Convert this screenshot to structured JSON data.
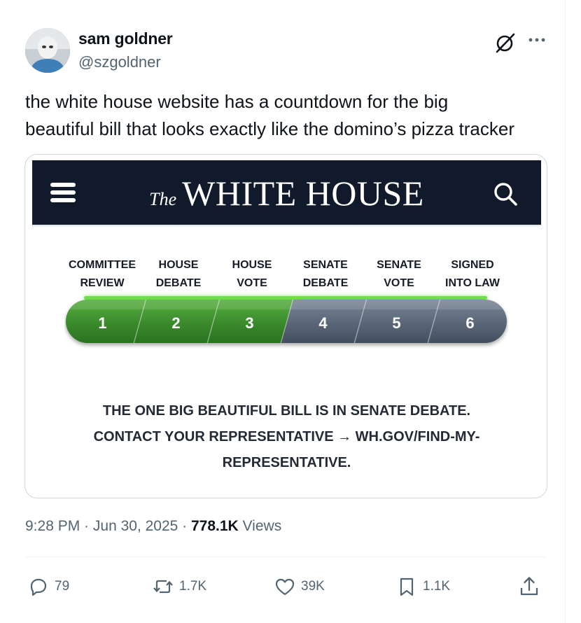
{
  "author": {
    "name": "sam goldner",
    "handle": "@szgoldner"
  },
  "tweet": {
    "text_line1": "the white house website has a countdown for the big",
    "text_line2": "beautiful bill that looks exactly like the domino’s pizza tracker"
  },
  "screenshot": {
    "logo_the": "The",
    "logo_main": "WHITE HOUSE",
    "stages": [
      {
        "label_line1": "COMMITTEE",
        "label_line2": "REVIEW",
        "number": "1"
      },
      {
        "label_line1": "HOUSE",
        "label_line2": "DEBATE",
        "number": "2"
      },
      {
        "label_line1": "HOUSE",
        "label_line2": "VOTE",
        "number": "3"
      },
      {
        "label_line1": "SENATE",
        "label_line2": "DEBATE",
        "number": "4"
      },
      {
        "label_line1": "SENATE",
        "label_line2": "VOTE",
        "number": "5"
      },
      {
        "label_line1": "SIGNED",
        "label_line2": "INTO LAW",
        "number": "6"
      }
    ],
    "completed_stages": 3,
    "message_line1": "THE ONE BIG BEAUTIFUL BILL IS IN SENATE DEBATE.",
    "message_line2": "CONTACT YOUR REPRESENTATIVE → WH.GOV/FIND-MY-",
    "message_line3": "REPRESENTATIVE."
  },
  "meta": {
    "time": "9:28 PM",
    "sep1": " · ",
    "date": "Jun 30, 2025",
    "sep2": " · ",
    "views_count": "778.1K",
    "views_label": " Views"
  },
  "actions": {
    "replies": "79",
    "reposts": "1.7K",
    "likes": "39K",
    "bookmarks": "1.1K"
  },
  "colors": {
    "completed": "#3a8a2c",
    "pending": "#5a6677",
    "header_bg": "#101a2b",
    "glow": "#6ee04a"
  },
  "icons": [
    "grok-icon",
    "more-icon",
    "menu-icon",
    "search-icon",
    "reply-icon",
    "repost-icon",
    "like-icon",
    "bookmark-icon",
    "share-icon"
  ]
}
